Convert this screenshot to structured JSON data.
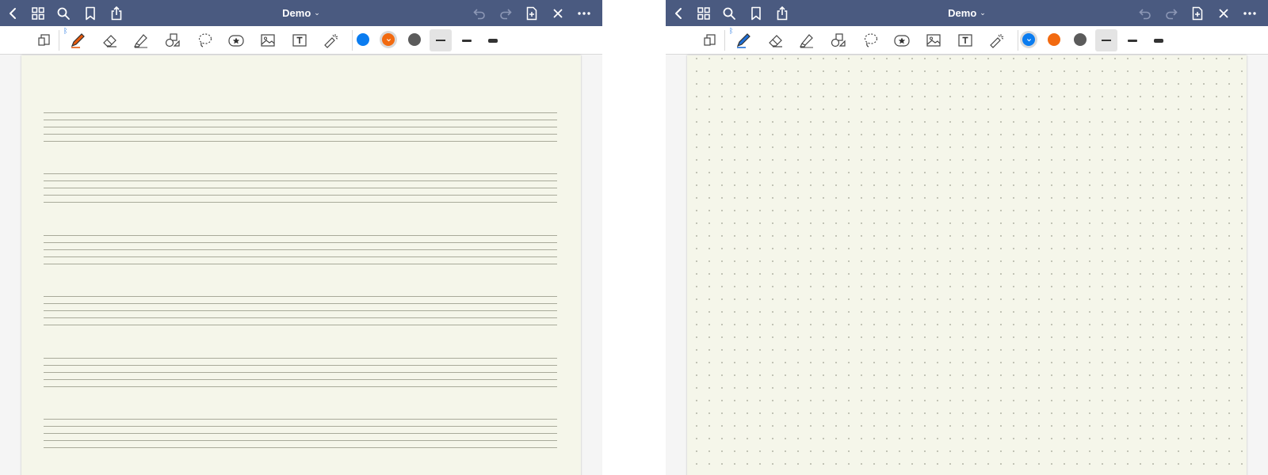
{
  "screens": [
    {
      "id": "left",
      "title": "Demo",
      "active_color": "#f26a10",
      "paper_template": "music-staff",
      "pen_color": "#e8590c"
    },
    {
      "id": "right",
      "title": "Demo",
      "active_color": "#0a7cf0",
      "paper_template": "dotted-grid",
      "pen_color": "#1f6fd6"
    }
  ],
  "palette": {
    "nav_bg": "#4a5a80",
    "paper_bg": "#f5f6ea",
    "colors": [
      "#0a7cf0",
      "#f26a10",
      "#5b5b5b"
    ]
  },
  "navbar": {
    "left_icons": [
      "back-chevron-icon",
      "grid-icon",
      "search-icon",
      "bookmark-icon",
      "share-icon"
    ],
    "right_icons": [
      "undo-icon",
      "redo-icon",
      "add-page-icon",
      "close-icon",
      "more-icon"
    ]
  },
  "toolbar": {
    "bluetooth_symbol": "ᛒ",
    "tools": [
      "page-zoom-icon",
      "pen-icon",
      "eraser-icon",
      "highlighter-icon",
      "shapes-icon",
      "lasso-icon",
      "sticker-icon",
      "image-icon",
      "text-icon",
      "laser-pointer-icon"
    ],
    "stroke_sizes": [
      "thin",
      "medium",
      "thick"
    ]
  }
}
